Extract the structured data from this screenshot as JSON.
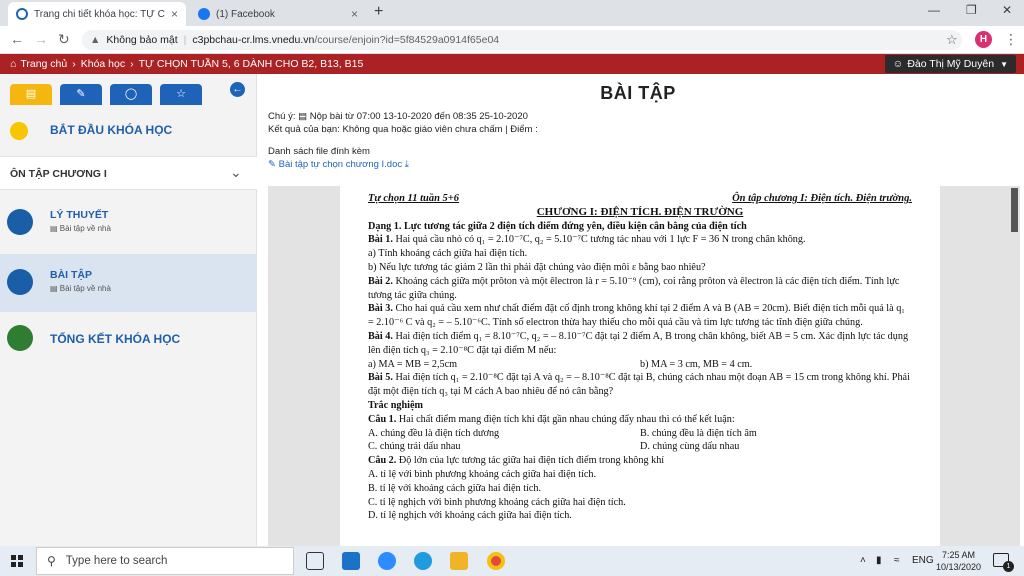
{
  "browser": {
    "tabs": [
      {
        "title": "Trang chi tiết khóa học: TỰ CHỌN",
        "active": true
      },
      {
        "title": "(1) Facebook",
        "active": false
      }
    ],
    "close_glyph": "×",
    "newtab_glyph": "+",
    "address": {
      "security": "Không bảo mật",
      "host": "c3pbchau-cr.lms.vnedu.vn",
      "path": "/course/enjoin?id=5f84529a0914f65e04"
    },
    "profile_initial": "H"
  },
  "site": {
    "breadcrumb": [
      "Trang chủ",
      "Khóa học",
      "TỰ CHỌN TUẦN 5, 6 DÀNH CHO B2, B13, B15"
    ],
    "user_name": "Đào Thị Mỹ Duyên"
  },
  "sidebar": {
    "start_label": "BẮT ĐẦU KHÓA HỌC",
    "chapter_label": "ÔN TẬP CHƯƠNG I",
    "items": [
      {
        "title": "LÝ THUYẾT",
        "sub": "Bài tập về nhà"
      },
      {
        "title": "BÀI TẬP",
        "sub": "Bài tập về nhà"
      },
      {
        "title": "TỔNG KẾT KHÓA HỌC",
        "sub": ""
      }
    ]
  },
  "main": {
    "title": "BÀI TẬP",
    "note_label": "Chú ý:",
    "note_text": "Nộp bài từ 07:00 13-10-2020 đến 08:35 25-10-2020",
    "result_label": "Kết quả của bạn:",
    "result_text": "Không qua hoặc giáo viên chưa chấm | Điểm :",
    "files_label": "Danh sách file đính kèm",
    "file_name": "Bài tập tự chọn chương I.doc"
  },
  "document": {
    "header_left": "Tự chọn 11 tuần 5+6",
    "header_right": "Ôn tập chương I: Điện tích. Điện trường.",
    "chapter": "CHƯƠNG I: ĐIỆN TÍCH. ĐIỆN TRƯỜNG",
    "section": "Dạng 1. Lực tương tác giữa 2 điện tích điểm đứng yên, điều kiện cân bằng của điện tích",
    "b1_label": "Bài 1.",
    "b1": "Hai quả cầu nhỏ có q₁ = 2.10⁻⁷C, q₂ = 5.10⁻⁷C tương tác nhau với 1 lực F = 36 N trong chân không.",
    "b1a": "a) Tính khoảng cách giữa hai điện tích.",
    "b1b": "b) Nếu lực tương tác giảm 2 lần thì phải đặt chúng vào điện môi ε bằng bao nhiêu?",
    "b2_label": "Bài 2.",
    "b2": "Khoảng cách giữa một prôton và một êlectron là r = 5.10⁻⁹ (cm), coi rằng prôton và êlectron là các điện tích điểm. Tính lực tương tác giữa chúng.",
    "b3_label": "Bài 3.",
    "b3": "Cho hai quả cầu xem như chất điểm đặt cố định trong không khí tại 2 điểm A và B (AB = 20cm). Biết điện tích mỗi quả là q₁ = 2.10⁻⁶ C và q₂ = – 5.10⁻⁶C. Tính số electron thừa hay thiếu cho mỗi quả cầu và tìm lực tương tác tĩnh điện giữa chúng.",
    "b4_label": "Bài 4.",
    "b4": "Hai điện tích điểm q₁ = 8.10⁻⁷C, q₂ = – 8.10⁻⁷C đặt tại 2 điểm A, B trong chân không, biết AB = 5 cm. Xác định lực tác dụng lên điện tích q₃ = 2.10⁻⁸C đặt tại điểm M nếu:",
    "b4a": "a) MA = MB = 2,5cm",
    "b4b": "b) MA = 3 cm, MB = 4 cm.",
    "b5_label": "Bài 5.",
    "b5": "Hai điện tích q₁ = 2.10⁻⁸C đặt tại A và q₂ = – 8.10⁻⁸C đặt tại B, chúng cách nhau một đoạn AB = 15 cm trong không khí. Phải đặt một điện tích q₃ tại M cách A bao nhiêu để nó cân bằng?",
    "mc_title": "Trắc nghiệm",
    "c1_label": "Câu 1.",
    "c1": "Hai chất điểm mang điện tích khi đặt gần nhau chúng đẩy nhau thì có thể kết luận:",
    "c1a": "A. chúng đều là điện tích dương",
    "c1b": "B. chúng đều là điện tích âm",
    "c1c": "C. chúng trái dấu nhau",
    "c1d": "D. chúng cùng dấu nhau",
    "c2_label": "Câu 2.",
    "c2": "Độ lớn của lực tương tác giữa hai điện tích điểm trong không khí",
    "c2a": "A. tỉ lệ với bình phương khoảng cách giữa hai điện tích.",
    "c2b": "B. tỉ lệ với khoảng cách giữa hai điện tích.",
    "c2c": "C. tỉ lệ nghịch với bình phương khoảng cách giữa hai điện tích.",
    "c2d": "D. tỉ lệ nghịch với khoảng cách giữa hai điện tích."
  },
  "taskbar": {
    "search_placeholder": "Type here to search",
    "lang": "ENG",
    "time": "7:25 AM",
    "date": "10/13/2020",
    "notif_count": "1"
  },
  "colors": {
    "site_red": "#ab2224",
    "primary_blue": "#1f63b8",
    "accent_yellow": "#f5b70f",
    "done_green": "#2e7d32"
  }
}
